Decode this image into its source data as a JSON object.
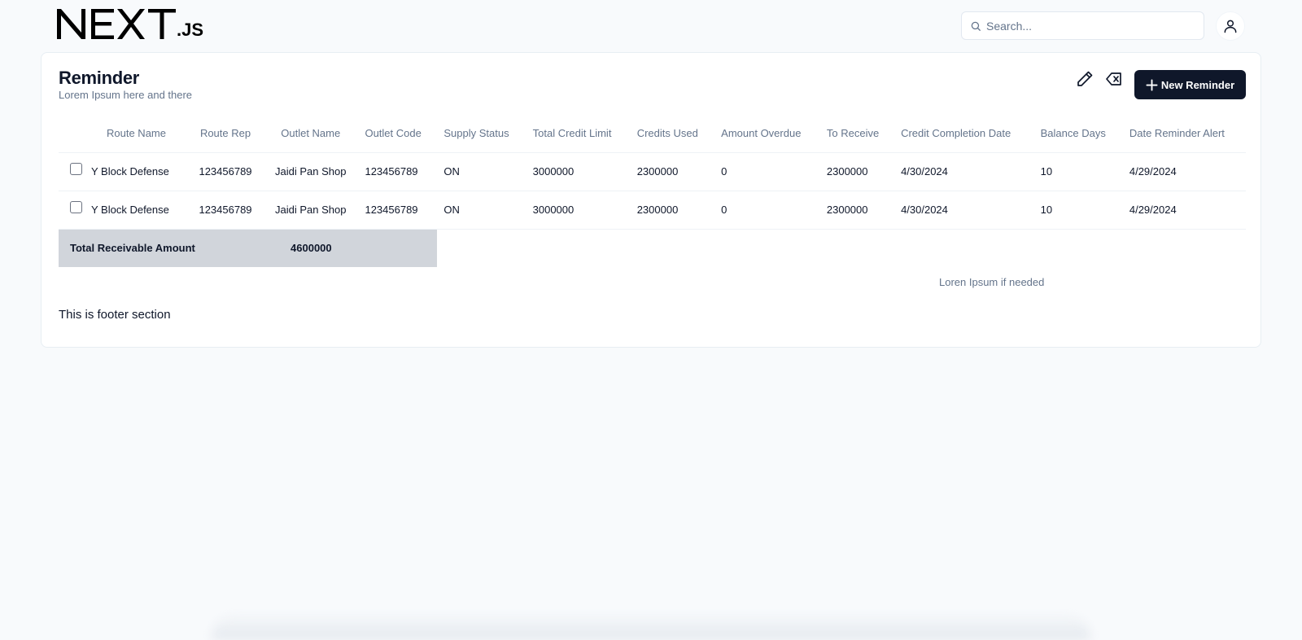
{
  "header": {
    "logo_main": "NEXT",
    "logo_suffix": ".JS",
    "search_placeholder": "Search...",
    "search_value": ""
  },
  "card": {
    "title": "Reminder",
    "subtitle": "Lorem Ipsum here and there",
    "new_button_label": "New Reminder"
  },
  "table": {
    "columns": [
      "Route Name",
      "Route Rep",
      "Outlet Name",
      "Outlet Code",
      "Supply Status",
      "Total Credit Limit",
      "Credits Used",
      "Amount Overdue",
      "To Receive",
      "Credit Completion Date",
      "Balance Days",
      "Date Reminder Alert"
    ],
    "rows": [
      [
        "Y Block Defense",
        "123456789",
        "Jaidi Pan Shop",
        "123456789",
        "ON",
        "3000000",
        "2300000",
        "0",
        "2300000",
        "4/30/2024",
        "10",
        "4/29/2024"
      ],
      [
        "Y Block Defense",
        "123456789",
        "Jaidi Pan Shop",
        "123456789",
        "ON",
        "3000000",
        "2300000",
        "0",
        "2300000",
        "4/30/2024",
        "10",
        "4/29/2024"
      ]
    ],
    "total_label": "Total Receivable Amount",
    "total_value": "4600000"
  },
  "note": "Loren Ipsum if needed",
  "footer": "This is footer section",
  "colors": {
    "background": "#f8fafc",
    "card": "#ffffff",
    "primary_button": "#0f172a",
    "total_row": "#d1d5db",
    "muted_text": "#64748b"
  },
  "icons": {
    "search": "search-icon",
    "user": "user-icon",
    "edit": "pencil-icon",
    "clear": "backspace-icon",
    "add": "plus-icon"
  }
}
